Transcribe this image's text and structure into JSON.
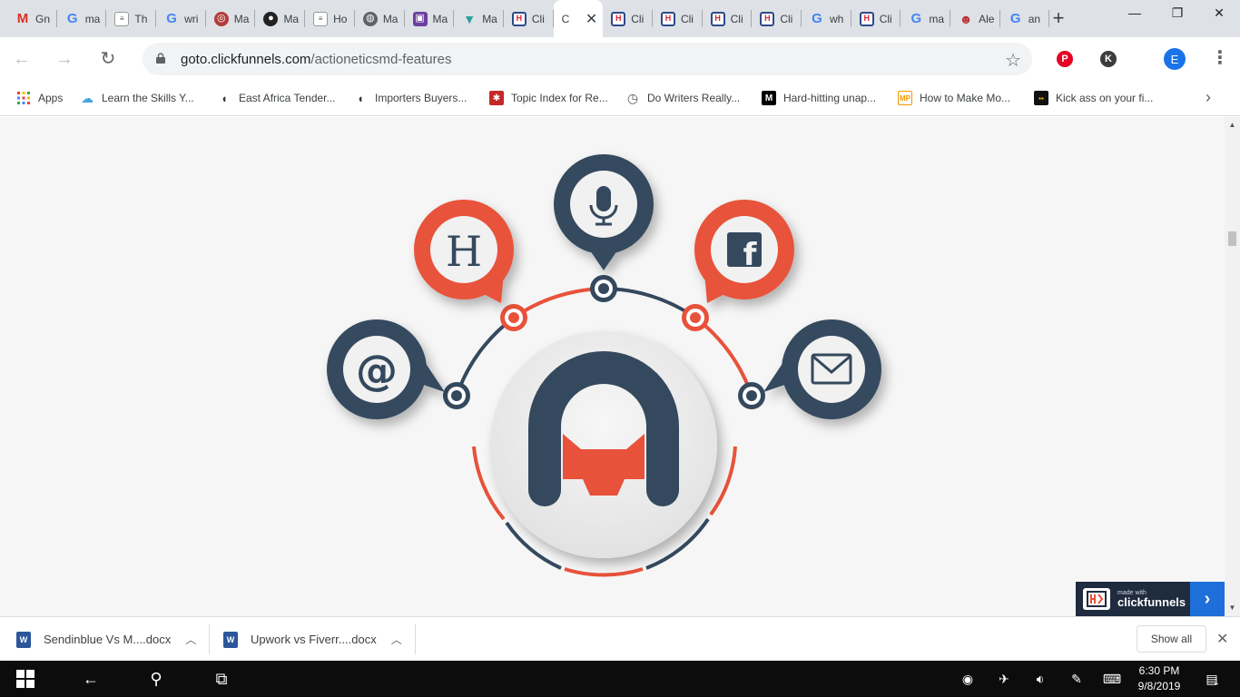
{
  "tabs": [
    {
      "title": "Gn",
      "icon": "gmail-icon"
    },
    {
      "title": "ma",
      "icon": "google-icon"
    },
    {
      "title": "Th",
      "icon": "doc-icon"
    },
    {
      "title": "wri",
      "icon": "google-icon"
    },
    {
      "title": "Ma",
      "icon": "disc-icon"
    },
    {
      "title": "Ma",
      "icon": "dark-circle-icon"
    },
    {
      "title": "Ho",
      "icon": "doc-icon"
    },
    {
      "title": "Ma",
      "icon": "globe-icon"
    },
    {
      "title": "Ma",
      "icon": "purple-icon"
    },
    {
      "title": "Ma",
      "icon": "teal-icon"
    },
    {
      "title": "Cli",
      "icon": "clickfunnels-icon"
    },
    {
      "title": "C",
      "icon": "active-blank-icon",
      "active": true
    },
    {
      "title": "Cli",
      "icon": "clickfunnels-icon"
    },
    {
      "title": "Cli",
      "icon": "clickfunnels-icon"
    },
    {
      "title": "Cli",
      "icon": "clickfunnels-icon"
    },
    {
      "title": "Cli",
      "icon": "clickfunnels-icon"
    },
    {
      "title": "wh",
      "icon": "google-icon"
    },
    {
      "title": "Cli",
      "icon": "clickfunnels-icon"
    },
    {
      "title": "ma",
      "icon": "google-icon"
    },
    {
      "title": "Ale",
      "icon": "mask-icon"
    },
    {
      "title": "an",
      "icon": "google-icon"
    }
  ],
  "address": {
    "domain": "goto.clickfunnels.com",
    "path": "/actioneticsmd-features"
  },
  "extensions": [
    {
      "letter": "P",
      "color": "#e60023"
    },
    {
      "letter": "K",
      "color": "#3c3c3c"
    }
  ],
  "profile_letter": "E",
  "bookmarks": [
    {
      "label": "Apps",
      "icon": "apps-grid-icon"
    },
    {
      "label": "Learn the Skills Y...",
      "icon": "learn-icon"
    },
    {
      "label": "East Africa Tender...",
      "icon": "tender-icon"
    },
    {
      "label": "Importers Buyers...",
      "icon": "importers-icon"
    },
    {
      "label": "Topic Index for Re...",
      "icon": "topic-icon"
    },
    {
      "label": "Do Writers Really...",
      "icon": "clock-icon"
    },
    {
      "label": "Hard-hitting unap...",
      "icon": "medium-icon"
    },
    {
      "label": "How to Make Mo...",
      "icon": "mp-icon"
    },
    {
      "label": "Kick ass on your fi...",
      "icon": "kick-icon"
    }
  ],
  "graphic": {
    "nodes": [
      "H",
      "f"
    ],
    "colors": {
      "orange": "#e8523a",
      "navy": "#34495e",
      "light": "#ececec"
    }
  },
  "cf_badge": {
    "small": "made with",
    "big": "clickfunnels"
  },
  "downloads": [
    {
      "name": "Sendinblue Vs M....docx"
    },
    {
      "name": "Upwork vs Fiverr....docx"
    }
  ],
  "show_all": "Show all",
  "clock": {
    "time": "6:30 PM",
    "date": "9/8/2019"
  },
  "notification_count": "1"
}
